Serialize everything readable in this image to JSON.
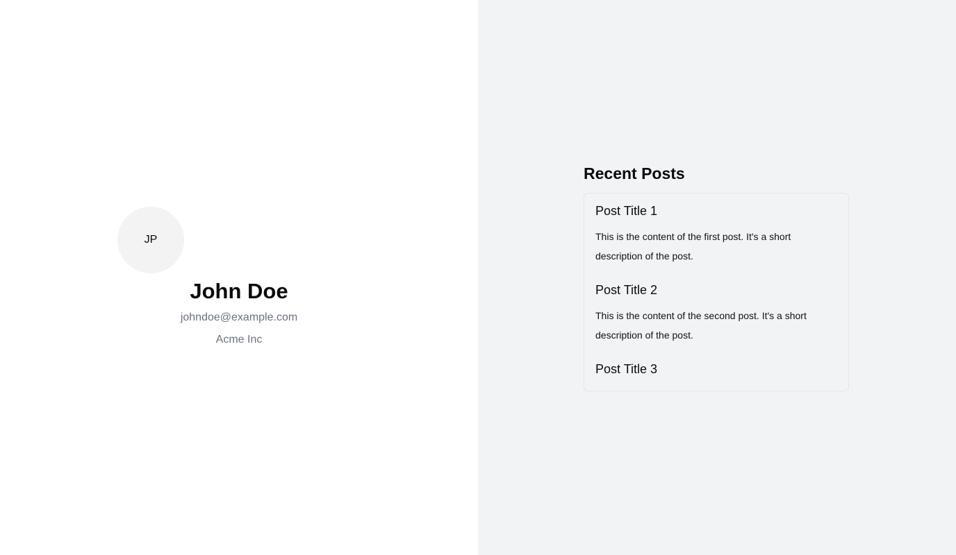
{
  "profile": {
    "avatar_initials": "JP",
    "name": "John Doe",
    "email": "johndoe@example.com",
    "company": "Acme Inc"
  },
  "posts": {
    "heading": "Recent Posts",
    "items": [
      {
        "title": "Post Title 1",
        "content": "This is the content of the first post. It's a short description of the post."
      },
      {
        "title": "Post Title 2",
        "content": "This is the content of the second post. It's a short description of the post."
      },
      {
        "title": "Post Title 3",
        "content": ""
      }
    ]
  },
  "colors": {
    "left_background": "#ffffff",
    "right_background": "#f2f3f5",
    "muted_text": "#6b7280",
    "avatar_background": "#f3f3f3"
  }
}
